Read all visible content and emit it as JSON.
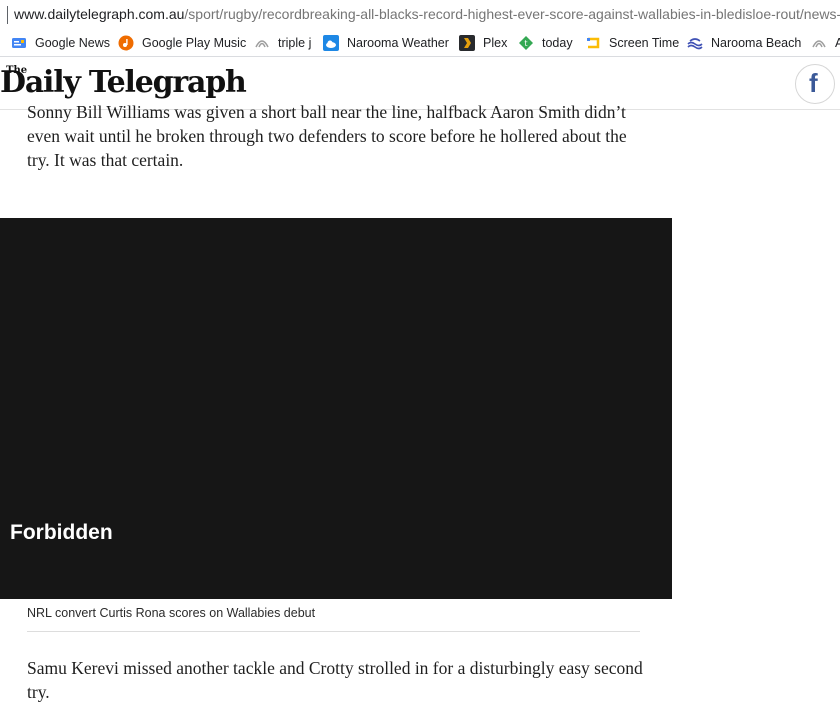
{
  "browser": {
    "url_host": "www.dailytelegraph.com.au",
    "url_path": "/sport/rugby/recordbreaking-all-blacks-record-highest-ever-score-against-wallabies-in-bledisloe-rout/news-story/"
  },
  "bookmarks": [
    {
      "label": "Google News",
      "icon": "google-news-icon",
      "color": "#4285f4"
    },
    {
      "label": "Google Play Music",
      "icon": "google-play-music-icon",
      "color": "#ef6c00"
    },
    {
      "label": "triple j",
      "icon": "triple-j-icon",
      "color": "#9e9e9e"
    },
    {
      "label": "Narooma Weather",
      "icon": "weather-cloud-icon",
      "color": "#1e88e5"
    },
    {
      "label": "Plex",
      "icon": "plex-icon",
      "color": "#e5a00d"
    },
    {
      "label": "today",
      "icon": "today-icon",
      "color": "#34a853"
    },
    {
      "label": "Screen Time",
      "icon": "screen-time-icon",
      "color": "#fbbc05"
    },
    {
      "label": "Narooma Beach",
      "icon": "beach-icon",
      "color": "#3f51b5"
    },
    {
      "label": "A",
      "icon": "abc-icon",
      "color": "#9e9e9e"
    }
  ],
  "site": {
    "logo_the": "The",
    "logo_name": "Daily Telegraph",
    "facebook_glyph": "f",
    "facebook_color": "#3b5998"
  },
  "article": {
    "para1": "Sonny Bill Williams was given a short ball near the line, halfback Aaron Smith didn’t even wait until he broken through two defenders to score before he hollered about the try. It was that certain.",
    "video_message": "Forbidden",
    "video_caption": "NRL convert Curtis Rona scores on Wallabies debut",
    "para2": "Samu Kerevi missed another tackle and Crotty strolled in for a disturbingly easy second try."
  }
}
